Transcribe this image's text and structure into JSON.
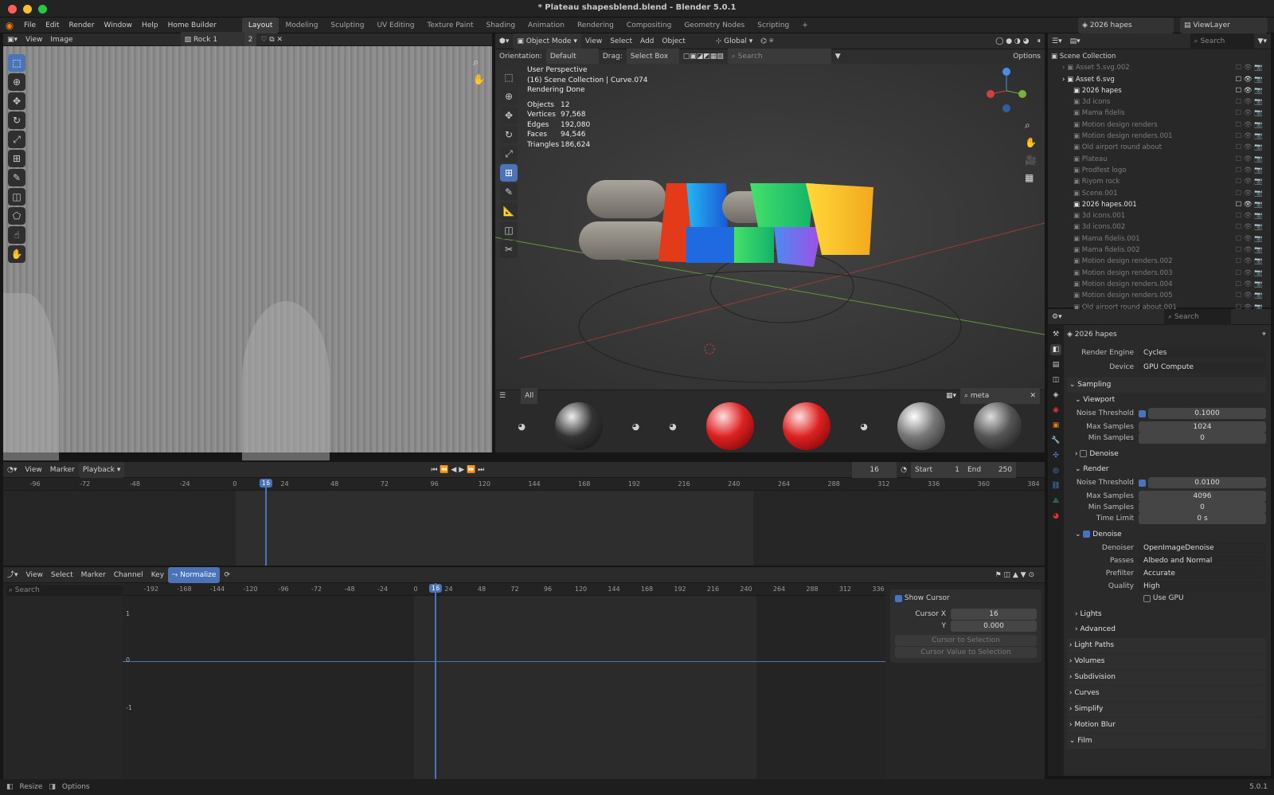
{
  "window": {
    "title": "* Plateau shapesblend.blend - Blender 5.0.1"
  },
  "menu": [
    "File",
    "Edit",
    "Render",
    "Window",
    "Help",
    "Home Builder"
  ],
  "workspaces": [
    "Layout",
    "Modeling",
    "Sculpting",
    "UV Editing",
    "Texture Paint",
    "Shading",
    "Animation",
    "Rendering",
    "Compositing",
    "Geometry Nodes",
    "Scripting"
  ],
  "active_workspace": "Layout",
  "top_right": {
    "scene": "2026 hapes",
    "view_layer": "ViewLayer"
  },
  "image_editor": {
    "menus": [
      "View",
      "Image"
    ],
    "image_name": "Rock 1",
    "users": "2"
  },
  "viewport": {
    "mode": "Object Mode",
    "menus": [
      "View",
      "Select",
      "Add",
      "Object"
    ],
    "orientation_global": "Global",
    "orientation_label": "Orientation:",
    "orientation_value": "Default",
    "drag_label": "Drag:",
    "drag_value": "Select Box",
    "search_placeholder": "Search",
    "options": "Options",
    "overlay": [
      "User Perspective",
      "(16) Scene Collection | Curve.074",
      "Rendering Done"
    ],
    "stats": [
      [
        "Objects",
        "12"
      ],
      [
        "Vertices",
        "97,568"
      ],
      [
        "Edges",
        "192,080"
      ],
      [
        "Faces",
        "94,546"
      ],
      [
        "Triangles",
        "186,624"
      ]
    ]
  },
  "asset_strip": {
    "filter": "All",
    "search": "meta"
  },
  "timeline": {
    "menus": [
      "View",
      "Marker",
      "Playback"
    ],
    "current": "16",
    "start_label": "Start",
    "start": "1",
    "end_label": "End",
    "end": "250",
    "ticks": [
      "-96",
      "-72",
      "-48",
      "-24",
      "0",
      "24",
      "48",
      "72",
      "96",
      "120",
      "144",
      "168",
      "192",
      "216",
      "240",
      "264",
      "288",
      "312",
      "336",
      "360",
      "384"
    ]
  },
  "graph": {
    "menus": [
      "View",
      "Select",
      "Marker",
      "Channel",
      "Key"
    ],
    "normalize": "Normalize",
    "search_placeholder": "Search",
    "ticks": [
      "-192",
      "-168",
      "-144",
      "-120",
      "-96",
      "-72",
      "-48",
      "-24",
      "0",
      "24",
      "48",
      "72",
      "96",
      "120",
      "144",
      "168",
      "192",
      "216",
      "240",
      "264",
      "288",
      "312",
      "336"
    ],
    "yticks": [
      "1",
      "0",
      "-1"
    ],
    "cursor_frame": "16",
    "panel": {
      "show_cursor": "Show Cursor",
      "cursor_x_label": "Cursor X",
      "cursor_x": "16",
      "y_label": "Y",
      "y": "0.000",
      "btn1": "Cursor to Selection",
      "btn2": "Cursor Value to Selection"
    }
  },
  "outliner": {
    "search_placeholder": "Search",
    "root": "Scene Collection",
    "items": [
      {
        "name": "Asset 5.svg.002",
        "ind": 1,
        "dim": true
      },
      {
        "name": "Asset 6.svg",
        "ind": 1,
        "dim": false
      },
      {
        "name": "2026 hapes",
        "ind": 2,
        "dim": false
      },
      {
        "name": "3d icons",
        "ind": 2,
        "dim": true
      },
      {
        "name": "Mama fidelis",
        "ind": 2,
        "dim": true
      },
      {
        "name": "Motion design renders",
        "ind": 2,
        "dim": true
      },
      {
        "name": "Motion design renders.001",
        "ind": 2,
        "dim": true
      },
      {
        "name": "Old airport round about",
        "ind": 2,
        "dim": true
      },
      {
        "name": "Plateau",
        "ind": 2,
        "dim": true
      },
      {
        "name": "Prodfest logo",
        "ind": 2,
        "dim": true
      },
      {
        "name": "Riyom rock",
        "ind": 2,
        "dim": true
      },
      {
        "name": "Scene.001",
        "ind": 2,
        "dim": true
      },
      {
        "name": "2026 hapes.001",
        "ind": 2,
        "dim": false
      },
      {
        "name": "3d icons.001",
        "ind": 2,
        "dim": true
      },
      {
        "name": "3d icons.002",
        "ind": 2,
        "dim": true
      },
      {
        "name": "Mama fidelis.001",
        "ind": 2,
        "dim": true
      },
      {
        "name": "Mama fidelis.002",
        "ind": 2,
        "dim": true
      },
      {
        "name": "Motion design renders.002",
        "ind": 2,
        "dim": true
      },
      {
        "name": "Motion design renders.003",
        "ind": 2,
        "dim": true
      },
      {
        "name": "Motion design renders.004",
        "ind": 2,
        "dim": true
      },
      {
        "name": "Motion design renders.005",
        "ind": 2,
        "dim": true
      },
      {
        "name": "Old airport round about.001",
        "ind": 2,
        "dim": true
      }
    ]
  },
  "properties": {
    "search_placeholder": "Search",
    "scene": "2026 hapes",
    "render_engine_label": "Render Engine",
    "render_engine": "Cycles",
    "device_label": "Device",
    "device": "GPU Compute",
    "sampling": "Sampling",
    "viewport": "Viewport",
    "noise_threshold_label": "Noise Threshold",
    "vp_noise": "0.1000",
    "max_samples_label": "Max Samples",
    "vp_max": "1024",
    "min_samples_label": "Min Samples",
    "vp_min": "0",
    "denoise": "Denoise",
    "render": "Render",
    "r_noise": "0.0100",
    "r_max": "4096",
    "r_min": "0",
    "time_limit_label": "Time Limit",
    "time_limit": "0 s",
    "denoiser_label": "Denoiser",
    "denoiser": "OpenImageDenoise",
    "passes_label": "Passes",
    "passes": "Albedo and Normal",
    "prefilter_label": "Prefilter",
    "prefilter": "Accurate",
    "quality_label": "Quality",
    "quality": "High",
    "use_gpu": "Use GPU",
    "lights": "Lights",
    "advanced": "Advanced",
    "sections": [
      "Light Paths",
      "Volumes",
      "Subdivision",
      "Curves",
      "Simplify",
      "Motion Blur",
      "Film"
    ]
  },
  "status": {
    "left1": "Resize",
    "left2": "Options",
    "version": "5.0.1"
  },
  "colors": {
    "accent": "#4a73b8"
  }
}
